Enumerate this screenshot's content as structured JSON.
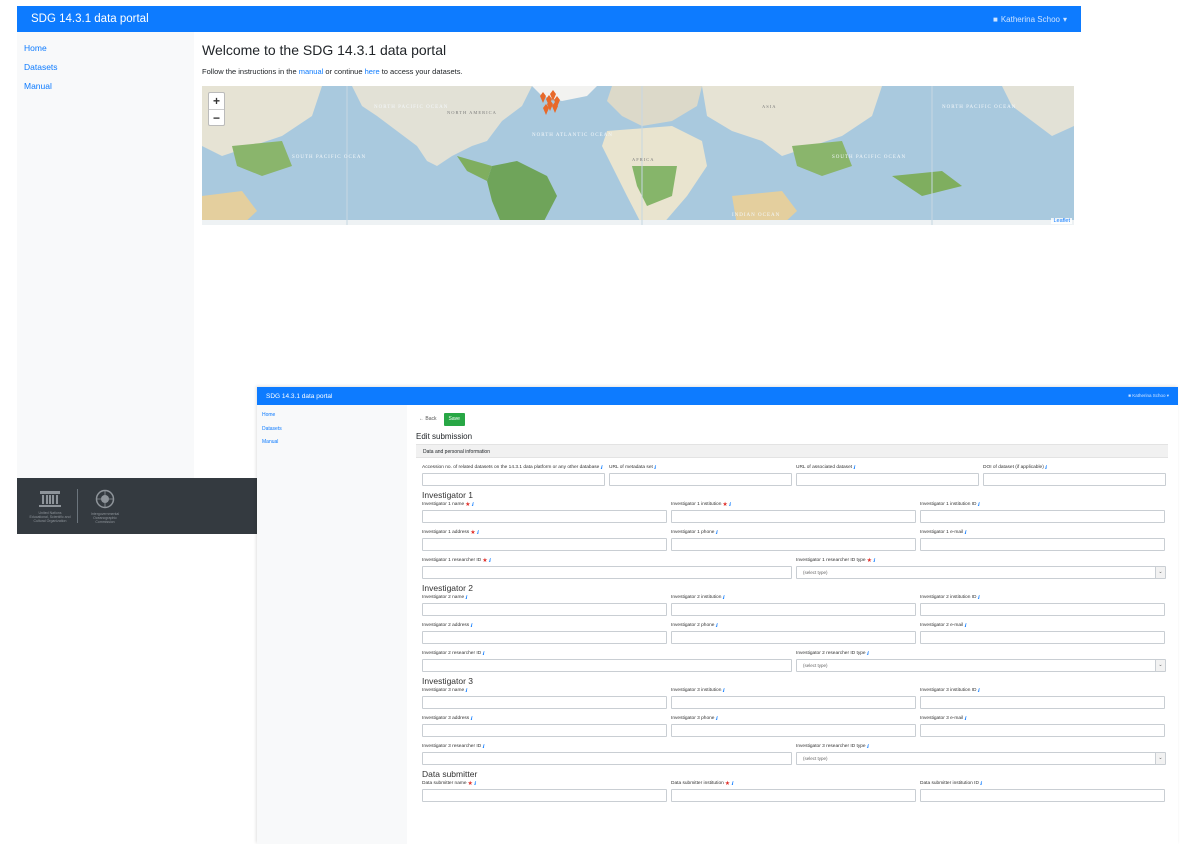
{
  "back_window": {
    "brand": "SDG 14.3.1 data portal",
    "user": "Katherina Schoo",
    "nav": [
      "Home",
      "Datasets",
      "Manual"
    ],
    "title": "Welcome to the SDG 14.3.1 data portal",
    "subtitle_pre": "Follow the instructions in the ",
    "subtitle_link1": "manual",
    "subtitle_mid": " or continue ",
    "subtitle_link2": "here",
    "subtitle_post": " to access your datasets.",
    "map": {
      "zoom_in": "+",
      "zoom_out": "−",
      "attribution": "Leaflet",
      "labels": [
        "NORTH PACIFIC OCEAN",
        "NORTH ATLANTIC OCEAN",
        "SOUTH PACIFIC OCEAN",
        "AFRICA",
        "ASIA",
        "NORTH AMERICA",
        "INDIAN OCEAN",
        "NORTH PACIFIC OCEAN",
        "SOUTH PACIFIC OCEAN"
      ],
      "marker_color": "#e8692a",
      "ocean_color": "#a9c9de",
      "land_color": "#e9e6dc"
    },
    "footer": {
      "logo1_text": "United Nations Educational, Scientific and Cultural Organization",
      "logo2_text": "Intergovernmental Oceanographic Commission"
    }
  },
  "front_window": {
    "brand": "SDG 14.3.1 data portal",
    "user": "Katherina Schoo",
    "nav": [
      "Home",
      "Datasets",
      "Manual"
    ],
    "back_label": "← Back",
    "save_label": "Save",
    "form_title": "Edit submission",
    "section_title": "Data and personal information",
    "top_fields": [
      {
        "label": "Accession no. of related datasets on the 14.3.1 data platform or any other database"
      },
      {
        "label": "URL of metadata set"
      },
      {
        "label": "URL of associated dataset"
      },
      {
        "label": "DOI of dataset (if applicable)"
      }
    ],
    "select_placeholder": "(select type)",
    "investigators": [
      {
        "heading": "Investigator 1",
        "row1": [
          {
            "label": "Investigator 1 name",
            "req": true
          },
          {
            "label": "Investigator 1 institution",
            "req": true
          },
          {
            "label": "Investigator 1 institution ID",
            "req": false
          }
        ],
        "row2": [
          {
            "label": "Investigator 1 address",
            "req": true
          },
          {
            "label": "Investigator 1 phone",
            "req": false
          },
          {
            "label": "Investigator 1 e-mail",
            "req": false
          }
        ],
        "row3": [
          {
            "label": "Investigator 1 researcher ID",
            "req": true
          },
          {
            "label": "Investigator 1 researcher ID type",
            "req": true
          }
        ]
      },
      {
        "heading": "Investigator 2",
        "row1": [
          {
            "label": "Investigator 2 name",
            "req": false
          },
          {
            "label": "Investigator 2 institution",
            "req": false
          },
          {
            "label": "Investigator 2 institution ID",
            "req": false
          }
        ],
        "row2": [
          {
            "label": "Investigator 2 address",
            "req": false
          },
          {
            "label": "Investigator 2 phone",
            "req": false
          },
          {
            "label": "Investigator 2 e-mail",
            "req": false
          }
        ],
        "row3": [
          {
            "label": "Investigator 2 researcher ID",
            "req": false
          },
          {
            "label": "Investigator 2 researcher ID type",
            "req": false
          }
        ]
      },
      {
        "heading": "Investigator 3",
        "row1": [
          {
            "label": "Investigator 3 name",
            "req": false
          },
          {
            "label": "Investigator 3 institution",
            "req": false
          },
          {
            "label": "Investigator 3 institution ID",
            "req": false
          }
        ],
        "row2": [
          {
            "label": "Investigator 3 address",
            "req": false
          },
          {
            "label": "Investigator 3 phone",
            "req": false
          },
          {
            "label": "Investigator 3 e-mail",
            "req": false
          }
        ],
        "row3": [
          {
            "label": "Investigator 3 researcher ID",
            "req": false
          },
          {
            "label": "Investigator 3 researcher ID type",
            "req": false
          }
        ]
      }
    ],
    "submitter": {
      "heading": "Data submitter",
      "row1": [
        {
          "label": "Data submitter name",
          "req": true
        },
        {
          "label": "Data submitter institution",
          "req": true
        },
        {
          "label": "Data submitter institution ID",
          "req": false
        }
      ]
    },
    "req_symbol": "★",
    "info_symbol": "ℹ"
  }
}
